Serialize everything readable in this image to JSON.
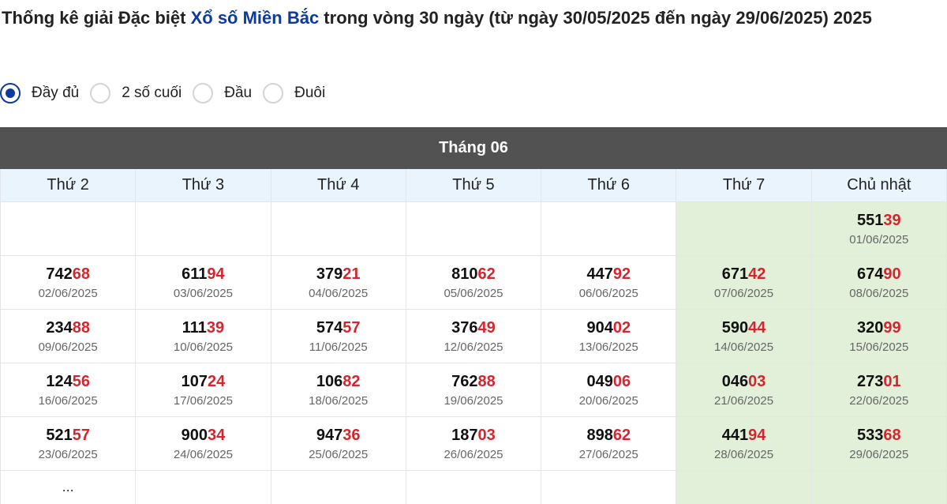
{
  "page": {
    "title_before": "Thống kê giải Đặc biệt ",
    "title_link": "Xổ số Miền Bắc",
    "title_after": " trong vòng 30 ngày (từ ngày 30/05/2025 đến ngày 29/06/2025) 2025",
    "accent_color": "#0d3a9e",
    "highlight_color": "#d3262e",
    "weekend_bg": "#e2f0da"
  },
  "filters": [
    {
      "label": "Đầy đủ",
      "checked": true
    },
    {
      "label": "2 số cuối",
      "checked": false
    },
    {
      "label": "Đầu",
      "checked": false
    },
    {
      "label": "Đuôi",
      "checked": false
    }
  ],
  "calendar": {
    "month_label": "Tháng 06",
    "days": [
      "Thứ 2",
      "Thứ 3",
      "Thứ 4",
      "Thứ 5",
      "Thứ 6",
      "Thứ 7",
      "Chủ nhật"
    ],
    "weeks": [
      [
        null,
        null,
        null,
        null,
        null,
        null,
        {
          "head": "551",
          "tail": "39",
          "date": "01/06/2025"
        }
      ],
      [
        {
          "head": "742",
          "tail": "68",
          "date": "02/06/2025"
        },
        {
          "head": "611",
          "tail": "94",
          "date": "03/06/2025"
        },
        {
          "head": "379",
          "tail": "21",
          "date": "04/06/2025"
        },
        {
          "head": "810",
          "tail": "62",
          "date": "05/06/2025"
        },
        {
          "head": "447",
          "tail": "92",
          "date": "06/06/2025"
        },
        {
          "head": "671",
          "tail": "42",
          "date": "07/06/2025"
        },
        {
          "head": "674",
          "tail": "90",
          "date": "08/06/2025"
        }
      ],
      [
        {
          "head": "234",
          "tail": "88",
          "date": "09/06/2025"
        },
        {
          "head": "111",
          "tail": "39",
          "date": "10/06/2025"
        },
        {
          "head": "574",
          "tail": "57",
          "date": "11/06/2025"
        },
        {
          "head": "376",
          "tail": "49",
          "date": "12/06/2025"
        },
        {
          "head": "904",
          "tail": "02",
          "date": "13/06/2025"
        },
        {
          "head": "590",
          "tail": "44",
          "date": "14/06/2025"
        },
        {
          "head": "320",
          "tail": "99",
          "date": "15/06/2025"
        }
      ],
      [
        {
          "head": "124",
          "tail": "56",
          "date": "16/06/2025"
        },
        {
          "head": "107",
          "tail": "24",
          "date": "17/06/2025"
        },
        {
          "head": "106",
          "tail": "82",
          "date": "18/06/2025"
        },
        {
          "head": "762",
          "tail": "88",
          "date": "19/06/2025"
        },
        {
          "head": "049",
          "tail": "06",
          "date": "20/06/2025"
        },
        {
          "head": "046",
          "tail": "03",
          "date": "21/06/2025"
        },
        {
          "head": "273",
          "tail": "01",
          "date": "22/06/2025"
        }
      ],
      [
        {
          "head": "521",
          "tail": "57",
          "date": "23/06/2025"
        },
        {
          "head": "900",
          "tail": "34",
          "date": "24/06/2025"
        },
        {
          "head": "947",
          "tail": "36",
          "date": "25/06/2025"
        },
        {
          "head": "187",
          "tail": "03",
          "date": "26/06/2025"
        },
        {
          "head": "898",
          "tail": "62",
          "date": "27/06/2025"
        },
        {
          "head": "441",
          "tail": "94",
          "date": "28/06/2025"
        },
        {
          "head": "533",
          "tail": "68",
          "date": "29/06/2025"
        }
      ]
    ],
    "last_row_first_cell": "..."
  }
}
